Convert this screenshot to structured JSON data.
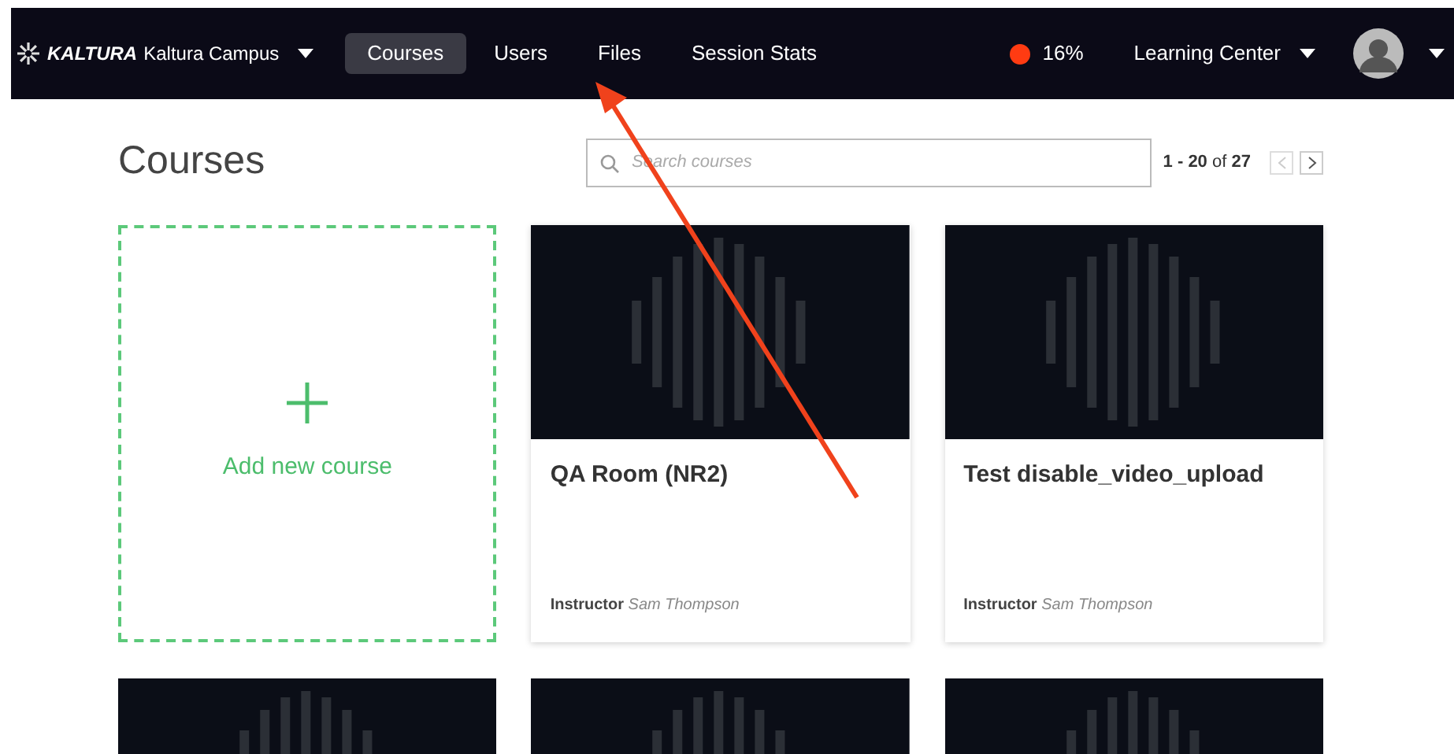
{
  "navbar": {
    "logo": "KALTURA",
    "campus": "Kaltura Campus",
    "tabs": [
      {
        "label": "Courses",
        "selected": true
      },
      {
        "label": "Users",
        "selected": false
      },
      {
        "label": "Files",
        "selected": false
      },
      {
        "label": "Session Stats",
        "selected": false
      }
    ],
    "status": {
      "color": "#ff3b12",
      "reading": "16%"
    },
    "center": "Learning Center"
  },
  "page": {
    "title": "Courses",
    "search": {
      "placeholder": "Search courses"
    },
    "pager": {
      "range": "1 - 20",
      "of": "of",
      "total": "27"
    }
  },
  "courses": [
    {
      "kind": "add",
      "label": "Add new course"
    },
    {
      "kind": "course",
      "title": "QA Room (NR2)",
      "instructor_label": "Instructor",
      "instructor": "Sam Thompson"
    },
    {
      "kind": "course",
      "title": "Test disable_video_upload",
      "instructor_label": "Instructor",
      "instructor": "Sam Thompson"
    },
    {
      "kind": "partial"
    },
    {
      "kind": "partial"
    },
    {
      "kind": "partial"
    }
  ]
}
